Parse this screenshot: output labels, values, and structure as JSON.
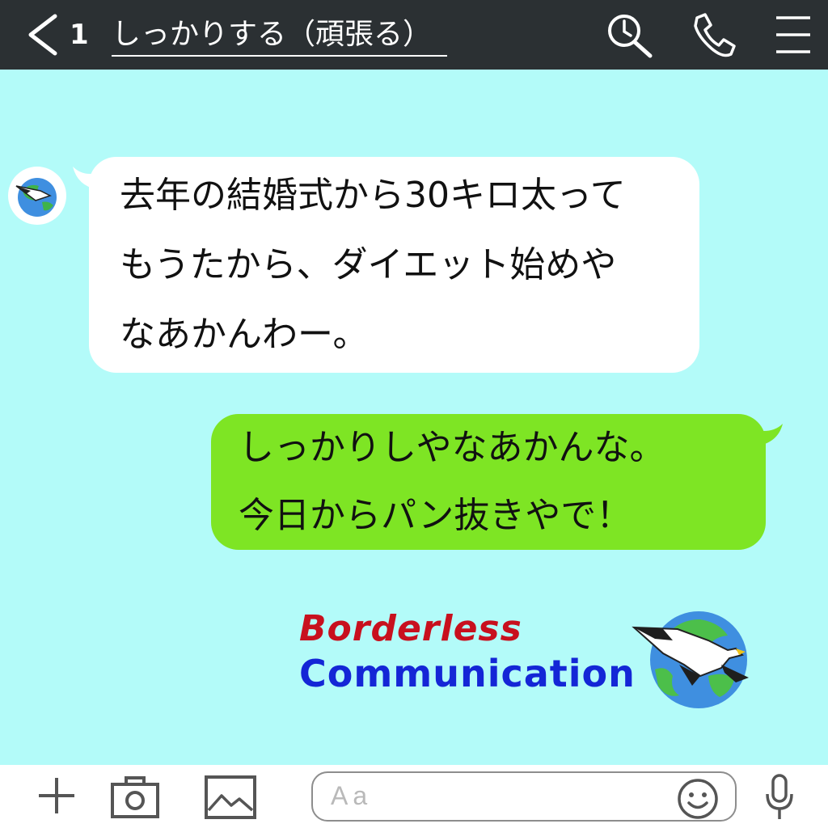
{
  "header": {
    "unread_count": "1",
    "title": "しっかりする（頑張る）"
  },
  "messages": [
    {
      "direction": "incoming",
      "lines": [
        "去年の結婚式から30キロ太って",
        "もうたから、ダイエット始めや",
        "なあかんわー。"
      ]
    },
    {
      "direction": "outgoing",
      "lines": [
        "しっかりしやなあかんな。",
        "今日からパン抜きやで！"
      ]
    }
  ],
  "brand": {
    "line1": "Borderless",
    "line2": "Communication"
  },
  "input": {
    "placeholder": "Aa"
  },
  "icons": {
    "header": [
      "chevron-left-icon",
      "search-icon",
      "phone-icon",
      "menu-icon"
    ],
    "bottom": [
      "plus-icon",
      "camera-icon",
      "image-icon",
      "emoji-icon",
      "microphone-icon"
    ]
  },
  "colors": {
    "header_bg": "#2b3033",
    "chat_bg": "#b3fbf9",
    "incoming_bubble": "#ffffff",
    "outgoing_bubble": "#7ee524",
    "brand_red": "#c8101e",
    "brand_blue": "#1426d6"
  }
}
